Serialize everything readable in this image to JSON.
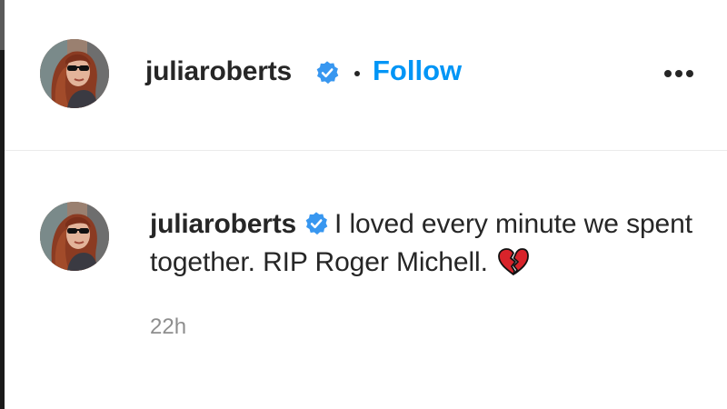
{
  "post_header": {
    "username": "juliaroberts",
    "verified": true,
    "separator": "•",
    "follow_label": "Follow",
    "more_icon": "more-options-icon"
  },
  "comment": {
    "username": "juliaroberts",
    "verified": true,
    "text": "I loved every minute we spent together. RIP Roger Michell.",
    "emoji_icon": "broken-heart-icon",
    "timestamp": "22h"
  },
  "colors": {
    "link_blue": "#0095f6",
    "verified_blue": "#3897f0",
    "text_primary": "#262626",
    "text_secondary": "#8e8e8e",
    "heart_red": "#d8232a"
  }
}
